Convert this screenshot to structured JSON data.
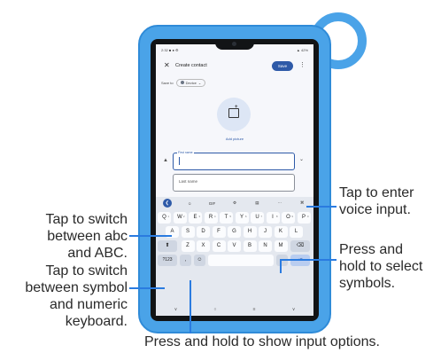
{
  "status_bar": {
    "time": "2:32",
    "icons": "■ ● ⚙",
    "right": "▲ 42%"
  },
  "app_bar": {
    "title": "Create contact",
    "save_label": "Save",
    "close_icon": "✕",
    "more_icon": "⋮"
  },
  "save_to": {
    "label": "Save to",
    "chip_label": "Device",
    "chevron": "⌄"
  },
  "photo": {
    "add_picture_label": "Add picture",
    "plus": "+"
  },
  "form": {
    "person_icon": "▲",
    "first_name_label": "First name",
    "last_name_placeholder": "Last name",
    "expand_icon": "⌄"
  },
  "keyboard": {
    "toolbar": [
      "❮",
      "☺",
      "GIF",
      "⚙",
      "▤",
      "⋯",
      "⌘"
    ],
    "row1": [
      "Q",
      "W",
      "E",
      "R",
      "T",
      "Y",
      "U",
      "I",
      "O",
      "P"
    ],
    "row1_sup": [
      "1",
      "2",
      "3",
      "4",
      "5",
      "6",
      "7",
      "8",
      "9",
      "0"
    ],
    "row2": [
      "A",
      "S",
      "D",
      "F",
      "G",
      "H",
      "J",
      "K",
      "L"
    ],
    "row3": [
      "Z",
      "X",
      "C",
      "V",
      "B",
      "N",
      "M"
    ],
    "shift": "⬆",
    "backspace": "⌫",
    "symbols": "?123",
    "comma": ",",
    "emoji": "☺",
    "period": ".",
    "enter": "⇥",
    "nav": [
      "∨",
      "○",
      "≡",
      "∨"
    ]
  },
  "callouts": {
    "voice_input": "Tap to enter\nvoice input.",
    "case_switch": "Tap to switch\nbetween abc\nand ABC.",
    "symbol_switch": "Tap to switch\nbetween symbol\nand numeric\nkeyboard.",
    "select_symbols": "Press and\nhold to select\nsymbols.",
    "input_options": "Press and hold to show input options."
  },
  "colors": {
    "case": "#4aa3e8",
    "accent": "#2e5aa8",
    "callout_line": "#2a7be0"
  }
}
